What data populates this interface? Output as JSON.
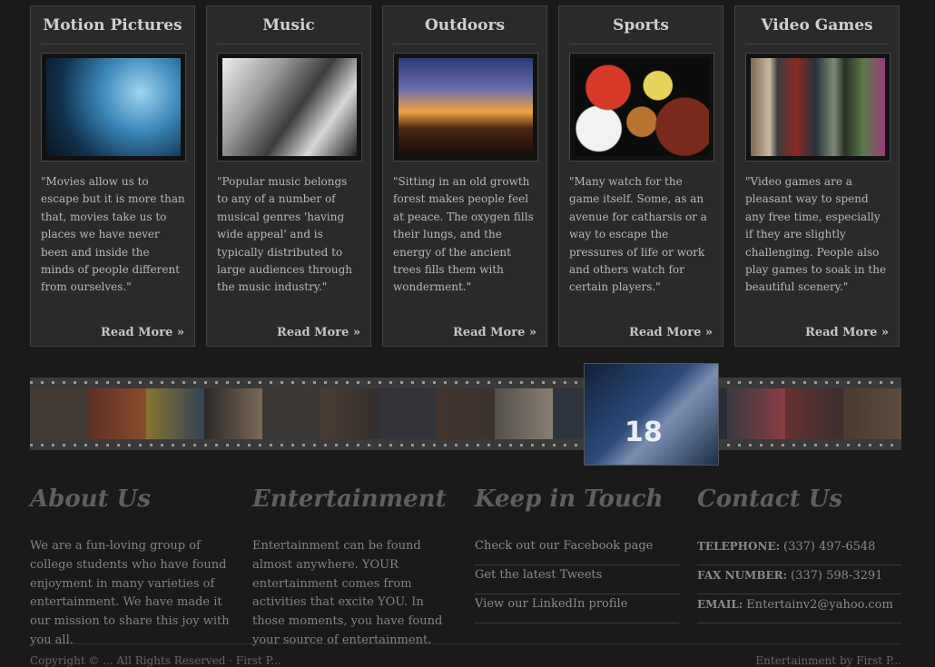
{
  "categories": [
    {
      "title": "Motion Pictures",
      "image": "film-projector-photo",
      "description": "\"Movies allow us to escape but it is more than that, movies take us to places we have never been and inside the minds of people different from ourselves.\"",
      "read_more": "Read More »"
    },
    {
      "title": "Music",
      "image": "microphone-and-mixer-photo",
      "description": "\"Popular music belongs to any of a number of musical genres 'having wide appeal' and is typically distributed to large audiences through the music industry.\"",
      "read_more": "Read More »"
    },
    {
      "title": "Outdoors",
      "image": "lake-sunset-photo",
      "description": "\"Sitting in an old growth forest makes people feel at peace. The oxygen fills their lungs, and the energy of the ancient trees fills them with wonderment.\"",
      "read_more": "Read More »"
    },
    {
      "title": "Sports",
      "image": "sports-balls-photo",
      "description": "\"Many watch for the game itself. Some, as an avenue for catharsis or a way to escape the pressures of life or work and others watch for certain players.\"",
      "read_more": "Read More »"
    },
    {
      "title": "Video Games",
      "image": "video-game-characters-photo",
      "description": "\"Video games are a pleasant way to spend any free time, especially if they are slightly challenging. People also play games to soak in the beautiful scenery.\"",
      "read_more": "Read More »"
    }
  ],
  "filmstrip": {
    "featured_image": "football-player-photo",
    "featured_number": "18"
  },
  "footer": {
    "about": {
      "heading": "About Us",
      "text": "We are a fun-loving group of college students who have found enjoyment in many varieties of entertainment. We have made it our mission to share this joy with you all."
    },
    "entertainment": {
      "heading": "Entertainment",
      "text": "Entertainment can be found almost anywhere. YOUR entertainment comes from activities that excite YOU. In those moments, you have found your source of entertainment."
    },
    "keep_in_touch": {
      "heading": "Keep in Touch",
      "links": [
        "Check out our Facebook page",
        "Get the latest Tweets",
        "View our LinkedIn profile"
      ]
    },
    "contact": {
      "heading": "Contact Us",
      "rows": [
        {
          "label": "TELEPHONE:",
          "value": "(337) 497-6548"
        },
        {
          "label": "FAX NUMBER:",
          "value": "(337) 598-3291"
        },
        {
          "label": "EMAIL:",
          "value": "Entertainv2@yahoo.com"
        }
      ]
    }
  },
  "copyright": {
    "left": "Copyright © ... All Rights Reserved · First P...",
    "right": "Entertainment by First P..."
  },
  "colors": {
    "background": "#1a1a1a",
    "card": "#2a2a2a",
    "heading": "#cfcfcf",
    "text": "#b9b9b9"
  }
}
